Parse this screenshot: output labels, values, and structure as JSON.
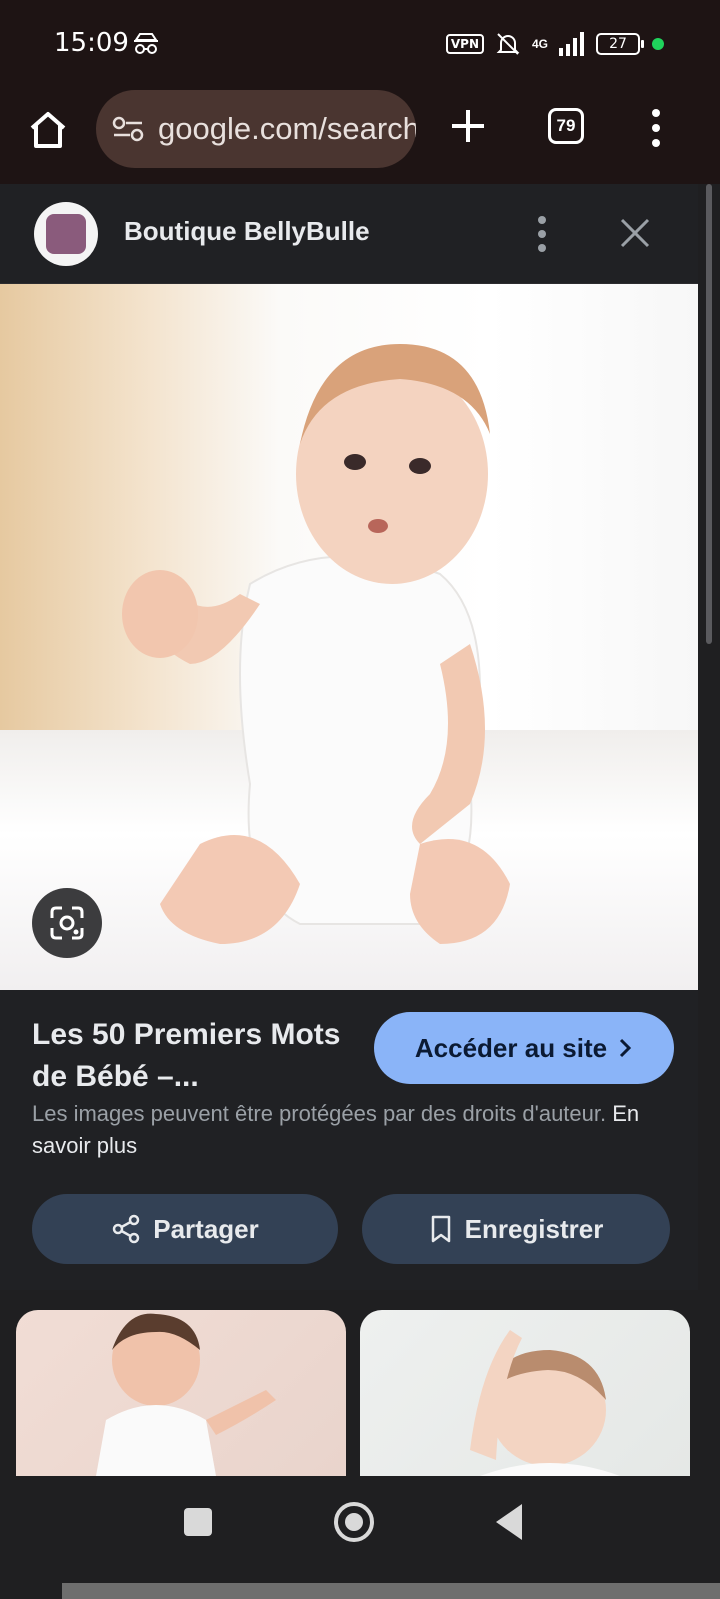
{
  "status_bar": {
    "time": "15:09",
    "vpn_label": "VPN",
    "network": "4G",
    "battery": "27"
  },
  "browser": {
    "url": "google.com/search",
    "tab_count": "79"
  },
  "sheet": {
    "site_name": "Boutique BellyBulle",
    "result_title": "Les 50 Premiers Mots de Bébé –...",
    "visit_label": "Accéder au site",
    "copyright_text": "Les images peuvent être protégées par des droits d'auteur.",
    "learn_more": "En savoir plus",
    "share_label": "Partager",
    "save_label": "Enregistrer"
  },
  "colors": {
    "accent": "#8ab4f8",
    "sheet_bg": "#202124",
    "button_bg": "#334155"
  }
}
